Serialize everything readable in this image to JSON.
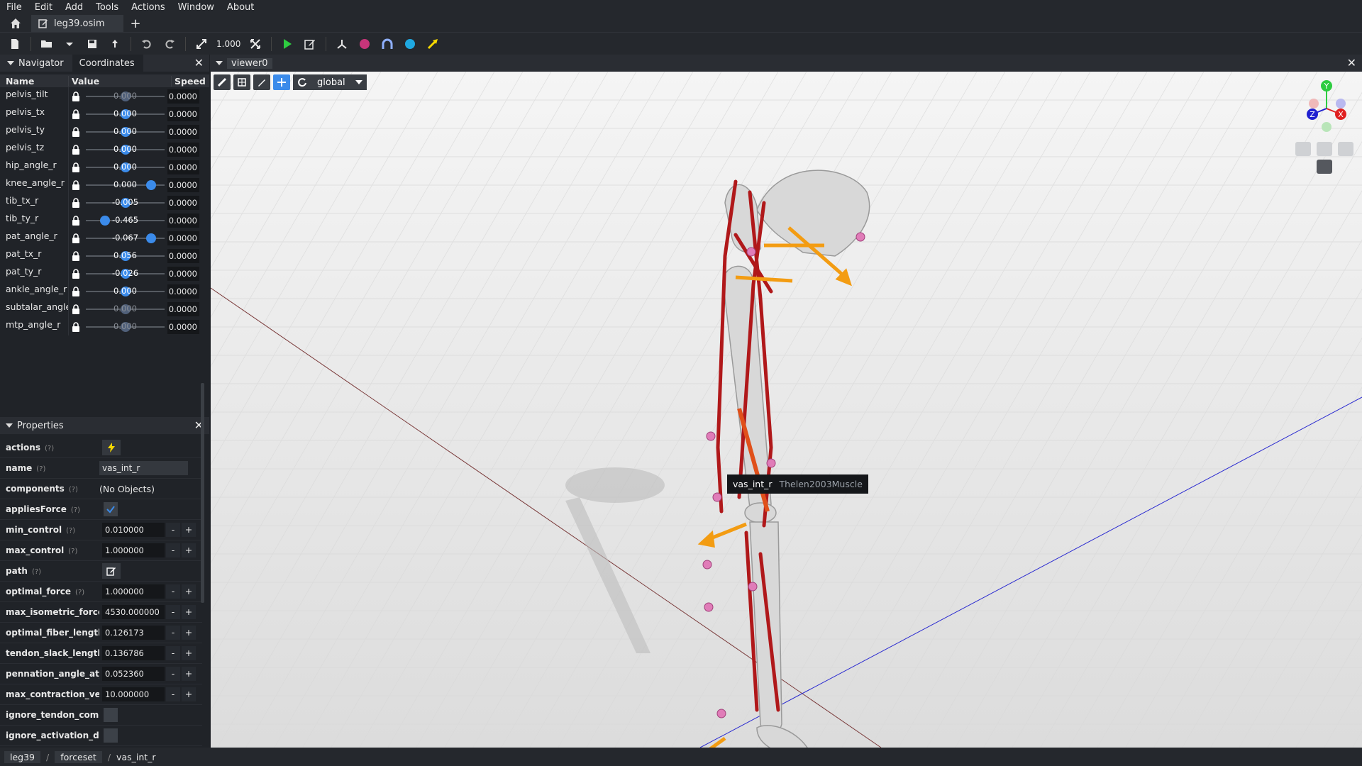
{
  "menu": [
    "File",
    "Edit",
    "Add",
    "Tools",
    "Actions",
    "Window",
    "About"
  ],
  "tabs": {
    "file_tab": "leg39.osim",
    "add": "+"
  },
  "toolbar": {
    "scale": "1.000"
  },
  "navigator": {
    "tab1": "Navigator",
    "tab2": "Coordinates"
  },
  "coords": {
    "headers": {
      "name": "Name",
      "value": "Value",
      "speed": "Speed"
    },
    "rows": [
      {
        "name": "pelvis_tilt",
        "value": "0.000",
        "speed": "0.0000",
        "knob": 0.5,
        "dim": true
      },
      {
        "name": "pelvis_tx",
        "value": "0.000",
        "speed": "0.0000",
        "knob": 0.5,
        "dim": false
      },
      {
        "name": "pelvis_ty",
        "value": "0.000",
        "speed": "0.0000",
        "knob": 0.5,
        "dim": false
      },
      {
        "name": "pelvis_tz",
        "value": "0.000",
        "speed": "0.0000",
        "knob": 0.5,
        "dim": false
      },
      {
        "name": "hip_angle_r",
        "value": "0.000",
        "speed": "0.0000",
        "knob": 0.5,
        "dim": false
      },
      {
        "name": "knee_angle_r",
        "value": "0.000",
        "speed": "0.0000",
        "knob": 0.88,
        "dim": false
      },
      {
        "name": "tib_tx_r",
        "value": "-0.005",
        "speed": "0.0000",
        "knob": 0.5,
        "dim": false
      },
      {
        "name": "tib_ty_r",
        "value": "-0.465",
        "speed": "0.0000",
        "knob": 0.21,
        "dim": false
      },
      {
        "name": "pat_angle_r",
        "value": "-0.067",
        "speed": "0.0000",
        "knob": 0.88,
        "dim": false
      },
      {
        "name": "pat_tx_r",
        "value": "0.056",
        "speed": "0.0000",
        "knob": 0.5,
        "dim": false
      },
      {
        "name": "pat_ty_r",
        "value": "-0.026",
        "speed": "0.0000",
        "knob": 0.5,
        "dim": false
      },
      {
        "name": "ankle_angle_r",
        "value": "0.000",
        "speed": "0.0000",
        "knob": 0.5,
        "dim": false
      },
      {
        "name": "subtalar_angle",
        "value": "0.000",
        "speed": "0.0000",
        "knob": 0.5,
        "dim": true
      },
      {
        "name": "mtp_angle_r",
        "value": "0.000",
        "speed": "0.0000",
        "knob": 0.5,
        "dim": true
      }
    ]
  },
  "properties": {
    "title": "Properties",
    "help": "(?)",
    "rows": [
      {
        "name": "actions",
        "kind": "action"
      },
      {
        "name": "name",
        "kind": "text",
        "value": "vas_int_r"
      },
      {
        "name": "components",
        "kind": "plain",
        "value": "(No Objects)"
      },
      {
        "name": "appliesForce",
        "kind": "check",
        "value": true
      },
      {
        "name": "min_control",
        "kind": "num",
        "value": "0.010000"
      },
      {
        "name": "max_control",
        "kind": "num",
        "value": "1.000000"
      },
      {
        "name": "path",
        "kind": "edit"
      },
      {
        "name": "optimal_force",
        "kind": "num",
        "value": "1.000000"
      },
      {
        "name": "max_isometric_force",
        "kind": "num",
        "value": "4530.000000"
      },
      {
        "name": "optimal_fiber_length",
        "kind": "num",
        "value": "0.126173"
      },
      {
        "name": "tendon_slack_length",
        "kind": "num",
        "value": "0.136786"
      },
      {
        "name": "pennation_angle_at_",
        "kind": "num",
        "value": "0.052360"
      },
      {
        "name": "max_contraction_vel",
        "kind": "num",
        "value": "10.000000"
      },
      {
        "name": "ignore_tendon_compl",
        "kind": "check",
        "value": false
      },
      {
        "name": "ignore_activation_dyr",
        "kind": "check",
        "value": false
      }
    ]
  },
  "viewer": {
    "title": "viewer0",
    "frame": "global",
    "tooltip_name": "vas_int_r",
    "tooltip_type": "Thelen2003Muscle",
    "axes": {
      "x": "X",
      "y": "Y",
      "z": "Z"
    }
  },
  "breadcrumb": [
    "leg39",
    "forceset",
    "vas_int_r"
  ],
  "colors": {
    "accent": "#3b8bea",
    "bone": "#d8d8d8",
    "muscle": "#b0181a",
    "marker": "#e07cb8",
    "force": "#f39c12"
  }
}
